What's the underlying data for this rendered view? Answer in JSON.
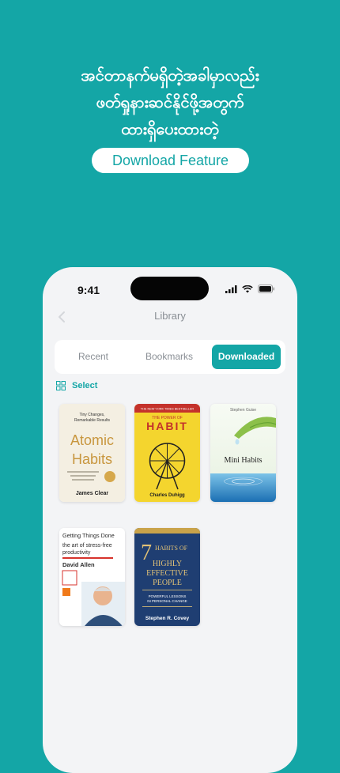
{
  "promo": {
    "heading_lines": [
      "အင်တာနက်မရှိတဲ့အခါမှာလည်း",
      "ဖတ်ရှုနားဆင်နိုင်ဖို့အတွက်",
      "ထားရှိပေးထားတဲ့"
    ],
    "feature_label": "Download Feature"
  },
  "phone": {
    "status_time": "9:41",
    "title": "Library",
    "tabs": [
      "Recent",
      "Bookmarks",
      "Downloaded"
    ],
    "active_tab": "Downloaded",
    "select_label": "Select"
  },
  "books": [
    {
      "title": "Atomic Habits",
      "title_lines": [
        "Atomic",
        "Habits"
      ],
      "tagline": "Tiny Changes, Remarkable Results",
      "tagline_lines": [
        "Tiny Changes,",
        "Remarkable Results"
      ],
      "author": "James Clear"
    },
    {
      "title": "HABIT",
      "banner": "THE NEW YORK TIMES BESTSELLER",
      "title_prefix": "THE POWER OF",
      "author": "Charles Duhigg"
    },
    {
      "title": "Mini Habits",
      "author": "Stephen Guise"
    },
    {
      "title": "Getting Things Done",
      "subtitle": "the art of stress-free productivity",
      "subtitle_lines": [
        "the art of stress-free",
        "productivity"
      ],
      "author": "David Allen"
    },
    {
      "title": "7 Habits of Highly Effective People",
      "title_number": "7",
      "title_lines": [
        "HABITS OF",
        "HIGHLY",
        "EFFECTIVE",
        "PEOPLE"
      ],
      "tagline": "POWERFUL LESSONS IN PERSONAL CHANGE",
      "tagline_lines": [
        "POWERFUL LESSONS",
        "IN PERSONAL CHANGE"
      ],
      "author": "Stephen R. Covey"
    }
  ],
  "colors": {
    "brand_teal": "#14a6a6",
    "pill_text": "#14a6a6",
    "inactive_tab": "#8a8f95",
    "phone_bg": "#f3f4f6"
  },
  "icons": [
    "back-arrow-icon",
    "grid-select-icon",
    "signal-icon",
    "wifi-icon",
    "battery-icon"
  ]
}
